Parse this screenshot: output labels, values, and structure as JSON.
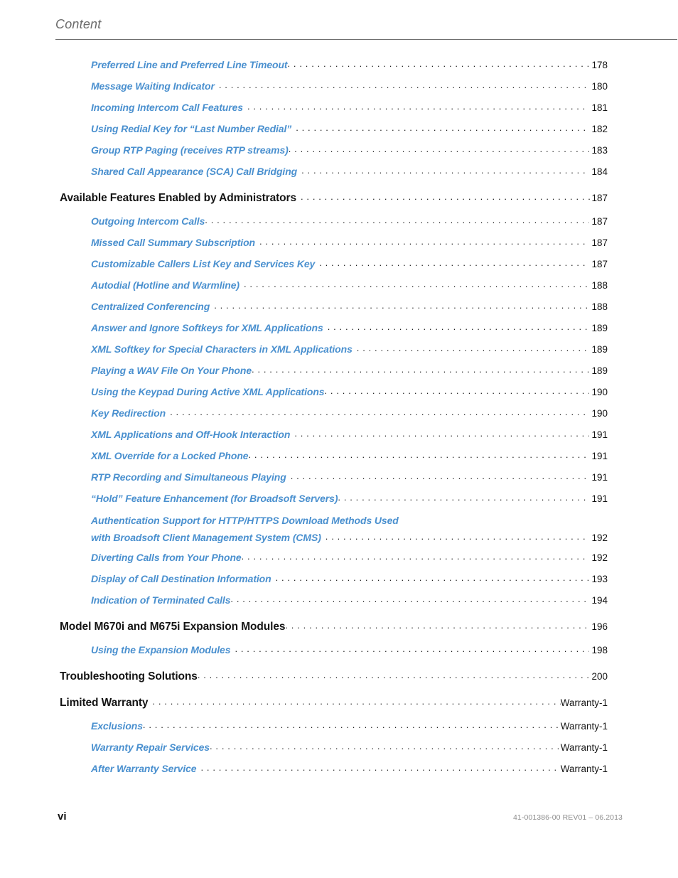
{
  "header": {
    "running_title": "Content"
  },
  "footer": {
    "folio": "vi",
    "doc_id": "41-001386-00 REV01 – 06.2013"
  },
  "colors": {
    "link_blue": "#4a90cf",
    "text_black": "#141414",
    "header_gray": "#6b6b6b",
    "rule_gray": "#6e6e6e"
  },
  "toc": {
    "entries": [
      {
        "level": 2,
        "title": "Preferred Line and Preferred Line Timeout",
        "page": "178",
        "gap": false
      },
      {
        "level": 2,
        "title": "Message Waiting Indicator",
        "page": "180",
        "gap": true
      },
      {
        "level": 2,
        "title": "Incoming Intercom Call Features",
        "page": "181",
        "gap": true
      },
      {
        "level": 2,
        "title": "Using Redial Key for “Last Number Redial”",
        "page": "182",
        "gap": true
      },
      {
        "level": 2,
        "title": "Group RTP Paging (receives RTP streams)",
        "page": "183",
        "gap": false
      },
      {
        "level": 2,
        "title": "Shared Call Appearance (SCA) Call Bridging",
        "page": "184",
        "gap": true
      },
      {
        "level": 1,
        "title": "Available Features Enabled by Administrators",
        "page": "187",
        "gap": true
      },
      {
        "level": 2,
        "title": "Outgoing Intercom Calls",
        "page": "187",
        "gap": false
      },
      {
        "level": 2,
        "title": "Missed Call Summary Subscription",
        "page": "187",
        "gap": true
      },
      {
        "level": 2,
        "title": "Customizable Callers List Key and Services Key",
        "page": "187",
        "gap": true
      },
      {
        "level": 2,
        "title": "Autodial (Hotline and Warmline)",
        "page": "188",
        "gap": true
      },
      {
        "level": 2,
        "title": "Centralized Conferencing",
        "page": "188",
        "gap": true
      },
      {
        "level": 2,
        "title": "Answer and Ignore Softkeys for XML Applications",
        "page": "189",
        "gap": true
      },
      {
        "level": 2,
        "title": "XML Softkey for Special Characters in XML Applications",
        "page": "189",
        "gap": true
      },
      {
        "level": 2,
        "title": "Playing a WAV File On Your Phone",
        "page": "189",
        "gap": false
      },
      {
        "level": 2,
        "title": "Using the Keypad During Active XML Applications",
        "page": "190",
        "gap": false
      },
      {
        "level": 2,
        "title": "Key Redirection",
        "page": "190",
        "gap": true
      },
      {
        "level": 2,
        "title": "XML Applications and Off-Hook Interaction",
        "page": "191",
        "gap": true
      },
      {
        "level": 2,
        "title": "XML Override for a Locked Phone",
        "page": "191",
        "gap": false
      },
      {
        "level": 2,
        "title": "RTP Recording and Simultaneous Playing",
        "page": "191",
        "gap": true
      },
      {
        "level": 2,
        "title": "“Hold” Feature Enhancement (for Broadsoft Servers)",
        "page": "191",
        "gap": false
      },
      {
        "level": 2,
        "wrapped": true,
        "title_line1": "Authentication Support for HTTP/HTTPS Download Methods Used",
        "title_line2": "with Broadsoft Client Management System (CMS)",
        "title": "Authentication Support for HTTP/HTTPS Download Methods Used with Broadsoft Client Management System (CMS)",
        "page": "192",
        "gap": true
      },
      {
        "level": 2,
        "title": "Diverting Calls from Your Phone",
        "page": "192",
        "gap": false
      },
      {
        "level": 2,
        "title": "Display of Call Destination Information",
        "page": "193",
        "gap": true
      },
      {
        "level": 2,
        "title": "Indication of Terminated Calls",
        "page": "194",
        "gap": false
      },
      {
        "level": 1,
        "title": "Model M670i and M675i Expansion Modules",
        "page": "196",
        "gap": false
      },
      {
        "level": 2,
        "title": "Using the Expansion Modules",
        "page": "198",
        "gap": true
      },
      {
        "level": 1,
        "title": "Troubleshooting Solutions",
        "page": "200",
        "gap": false
      },
      {
        "level": 1,
        "title": "Limited Warranty",
        "page": "Warranty-1",
        "gap": true
      },
      {
        "level": 2,
        "title": "Exclusions",
        "page": "Warranty-1",
        "gap": false
      },
      {
        "level": 2,
        "title": "Warranty Repair Services",
        "page": "Warranty-1",
        "gap": false
      },
      {
        "level": 2,
        "title": "After Warranty Service",
        "page": "Warranty-1",
        "gap": true
      }
    ]
  }
}
